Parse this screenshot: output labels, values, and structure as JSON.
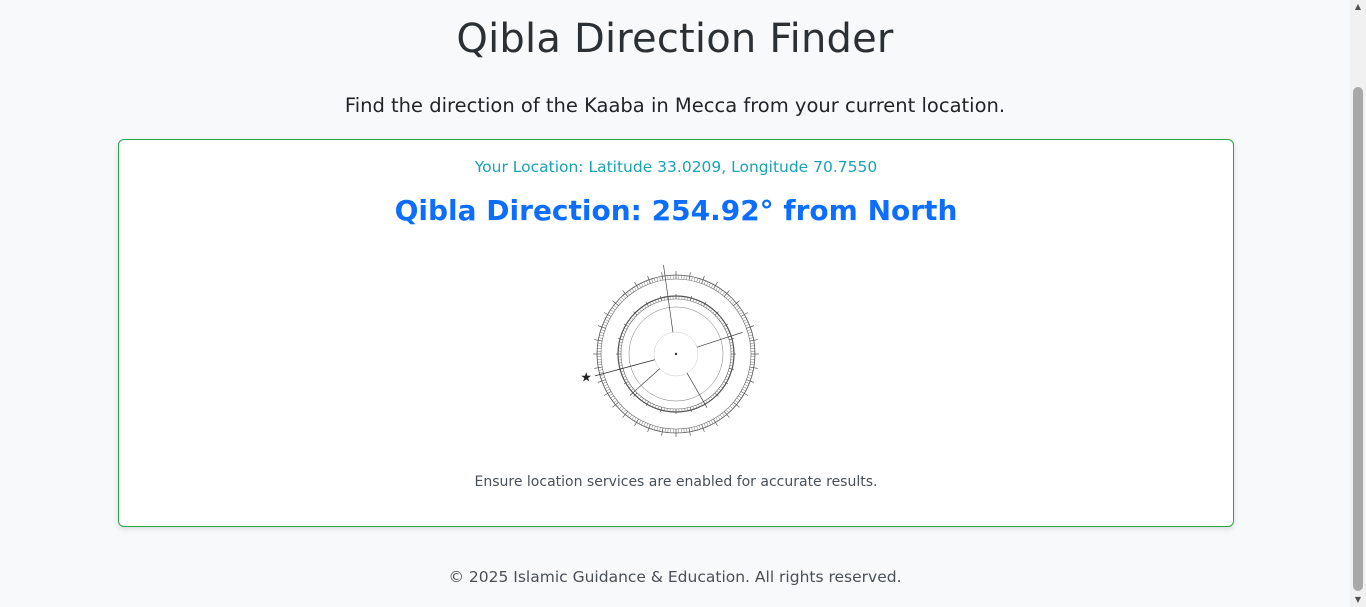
{
  "header": {
    "title": "Qibla Direction Finder",
    "subtitle": "Find the direction of the Kaaba in Mecca from your current location."
  },
  "card": {
    "location_text": "Your Location: Latitude 33.0209, Longitude 70.7550",
    "direction_text": "Qibla Direction: 254.92° from North",
    "qibla_bearing_deg": 254.92,
    "note": "Ensure location services are enabled for accurate results."
  },
  "footer": {
    "copyright": "© 2025 Islamic Guidance & Education. All rights reserved."
  },
  "colors": {
    "card_border": "#28a745",
    "location": "#17a2b8",
    "direction": "#0d6efd",
    "background": "#f8f9fa"
  },
  "icons": {
    "compass": "compass-dial-icon",
    "kaaba_marker": "star-icon"
  }
}
